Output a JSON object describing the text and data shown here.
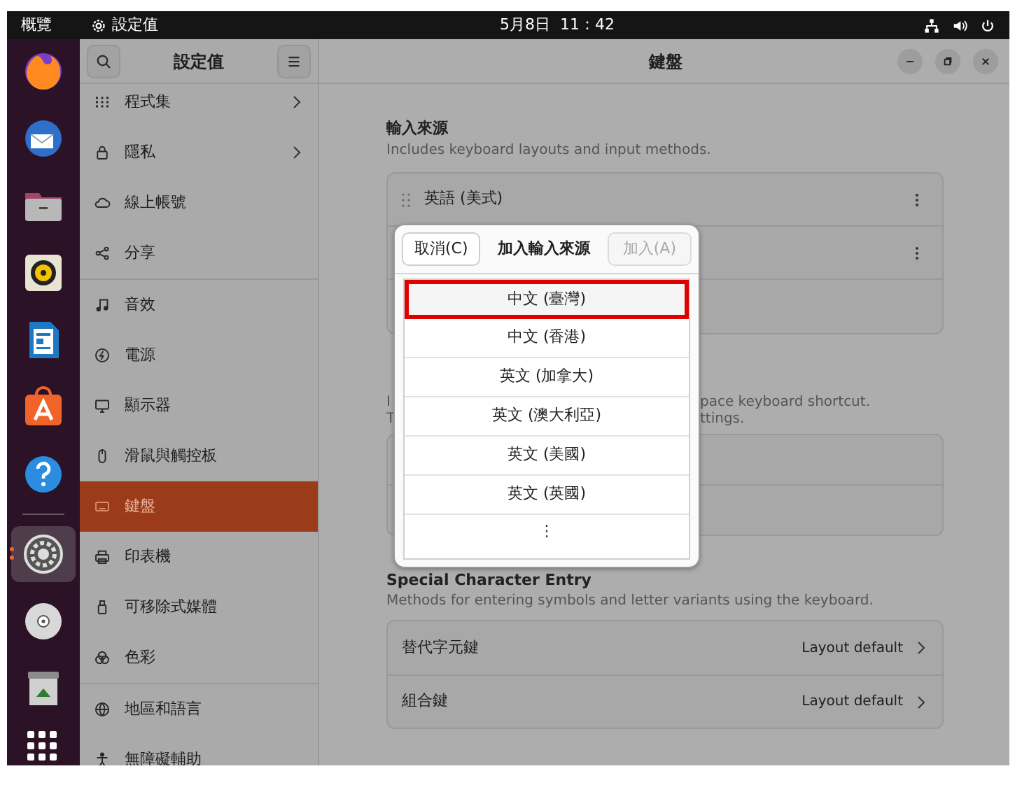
{
  "top_bar": {
    "activities": "概覽",
    "app_menu": "設定值",
    "clock": "5月8日  11：42"
  },
  "dock": [
    {
      "selected": false
    },
    {
      "selected": false
    },
    {
      "selected": false
    },
    {
      "selected": false
    },
    {
      "selected": false
    },
    {
      "selected": false
    },
    {
      "selected": false
    },
    {
      "selected": true
    },
    {
      "selected": false
    },
    {
      "selected": false
    }
  ],
  "sidebar": {
    "title": "設定值",
    "groups": [
      [
        {
          "label": "程式集",
          "submenu": true,
          "selected": false
        },
        {
          "label": "隱私",
          "submenu": true,
          "selected": false
        },
        {
          "label": "線上帳號",
          "submenu": false,
          "selected": false
        },
        {
          "label": "分享",
          "submenu": false,
          "selected": false
        }
      ],
      [
        {
          "label": "音效",
          "submenu": false,
          "selected": false
        },
        {
          "label": "電源",
          "submenu": false,
          "selected": false
        },
        {
          "label": "顯示器",
          "submenu": false,
          "selected": false
        },
        {
          "label": "滑鼠與觸控板",
          "submenu": false,
          "selected": false
        },
        {
          "label": "鍵盤",
          "submenu": false,
          "selected": true
        },
        {
          "label": "印表機",
          "submenu": false,
          "selected": false
        },
        {
          "label": "可移除式媒體",
          "submenu": false,
          "selected": false
        },
        {
          "label": "色彩",
          "submenu": false,
          "selected": false
        }
      ],
      [
        {
          "label": "地區和語言",
          "submenu": false,
          "selected": false
        },
        {
          "label": "無障礙輔助",
          "submenu": false,
          "selected": false
        }
      ]
    ]
  },
  "window": {
    "title": "鍵盤"
  },
  "input_sources": {
    "heading": "輸入來源",
    "description": "Includes keyboard layouts and input methods.",
    "rows": [
      {
        "label": "英語 (美式)"
      },
      {
        "label": null
      }
    ]
  },
  "switching": {
    "lines": [
      {
        "left": "I",
        "right": "pace keyboard shortcut."
      },
      {
        "left": "T",
        "right": "ttings."
      }
    ]
  },
  "special": {
    "heading": "Special Character Entry",
    "description": "Methods for entering symbols and letter variants using the keyboard.",
    "rows": [
      {
        "label": "替代字元鍵",
        "value": "Layout default"
      },
      {
        "label": "組合鍵",
        "value": "Layout default"
      }
    ]
  },
  "dialog": {
    "cancel": "取消(C)",
    "title": "加入輸入來源",
    "add": {
      "label": "加入(A)",
      "disabled": true
    },
    "options": [
      {
        "label": "中文 (臺灣)",
        "selected": true
      },
      {
        "label": "中文 (香港)",
        "selected": false
      },
      {
        "label": "英文 (加拿大)",
        "selected": false
      },
      {
        "label": "英文 (澳大利亞)",
        "selected": false
      },
      {
        "label": "英文 (美國)",
        "selected": false
      },
      {
        "label": "英文 (英國)",
        "selected": false
      }
    ],
    "more": "⋮"
  }
}
